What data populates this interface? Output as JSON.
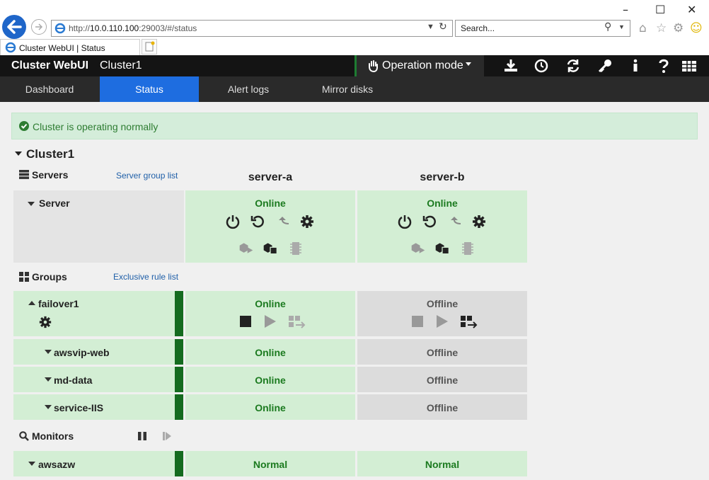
{
  "browser": {
    "url_prefix": "http://",
    "url_host": "10.0.110.100",
    "url_rest": ":29003/#/status",
    "search_placeholder": "Search...",
    "tab_title": "Cluster WebUI | Status"
  },
  "header": {
    "brand": "Cluster WebUI",
    "cluster_name": "Cluster1",
    "operation_mode": "Operation mode"
  },
  "nav_tabs": [
    {
      "label": "Dashboard",
      "active": false
    },
    {
      "label": "Status",
      "active": true
    },
    {
      "label": "Alert logs",
      "active": false
    },
    {
      "label": "Mirror disks",
      "active": false
    }
  ],
  "alert": {
    "text": "Cluster is operating normally"
  },
  "cluster": {
    "title": "Cluster1"
  },
  "servers_section": {
    "title": "Servers",
    "link": "Server group list"
  },
  "server_columns": [
    "server-a",
    "server-b"
  ],
  "server_row": {
    "label": "Server",
    "status": [
      "Online",
      "Online"
    ]
  },
  "groups_section": {
    "title": "Groups",
    "link": "Exclusive rule list"
  },
  "groups": [
    {
      "label": "failover1",
      "status": [
        "Online",
        "Offline"
      ]
    }
  ],
  "resources": [
    {
      "label": "awsvip-web",
      "status": [
        "Online",
        "Offline"
      ]
    },
    {
      "label": "md-data",
      "status": [
        "Online",
        "Offline"
      ]
    },
    {
      "label": "service-IIS",
      "status": [
        "Online",
        "Offline"
      ]
    }
  ],
  "monitors_section": {
    "title": "Monitors"
  },
  "monitors": [
    {
      "label": "awsazw",
      "status": [
        "Normal",
        "Normal"
      ]
    }
  ],
  "colors": {
    "online": "#1b7a1f",
    "accent": "#1e6de0",
    "green_bg": "#d3eed4",
    "offline_bg": "#dcdcdc"
  }
}
